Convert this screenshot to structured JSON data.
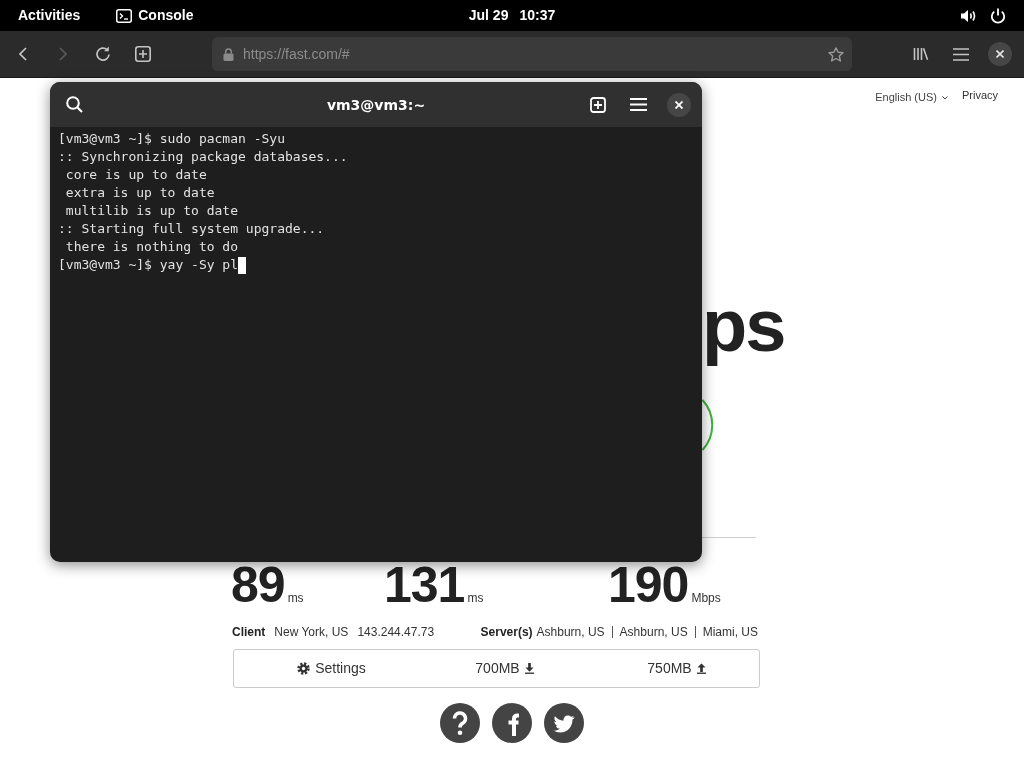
{
  "top_bar": {
    "activities": "Activities",
    "app": "Console",
    "date": "Jul 29",
    "time": "10:37"
  },
  "browser": {
    "back": {
      "disabled": false
    },
    "forward": {
      "disabled": true
    },
    "url": "https://fast.com/#"
  },
  "page": {
    "language": "English (US)",
    "privacy": "Privacy",
    "speed_unit_fragment": "ps",
    "metrics": [
      {
        "value": "89",
        "unit": "ms"
      },
      {
        "value": "131",
        "unit": "ms"
      },
      {
        "value": "190",
        "unit": "Mbps"
      }
    ],
    "client": {
      "label": "Client",
      "location": "New York, US",
      "ip": "143.244.47.73"
    },
    "servers": {
      "label": "Server(s)",
      "locations": [
        "Ashburn, US",
        "Ashburn, US",
        "Miami, US"
      ]
    },
    "settings_bar": {
      "settings": "Settings",
      "download": "700MB",
      "upload": "750MB"
    }
  },
  "terminal": {
    "title": "vm3@vm3:~",
    "lines": [
      "[vm3@vm3 ~]$ sudo pacman -Syu",
      ":: Synchronizing package databases...",
      " core is up to date",
      " extra is up to date",
      " multilib is up to date",
      ":: Starting full system upgrade...",
      " there is nothing to do",
      "[vm3@vm3 ~]$ yay -Sy pl"
    ],
    "cursor_visible": true
  }
}
